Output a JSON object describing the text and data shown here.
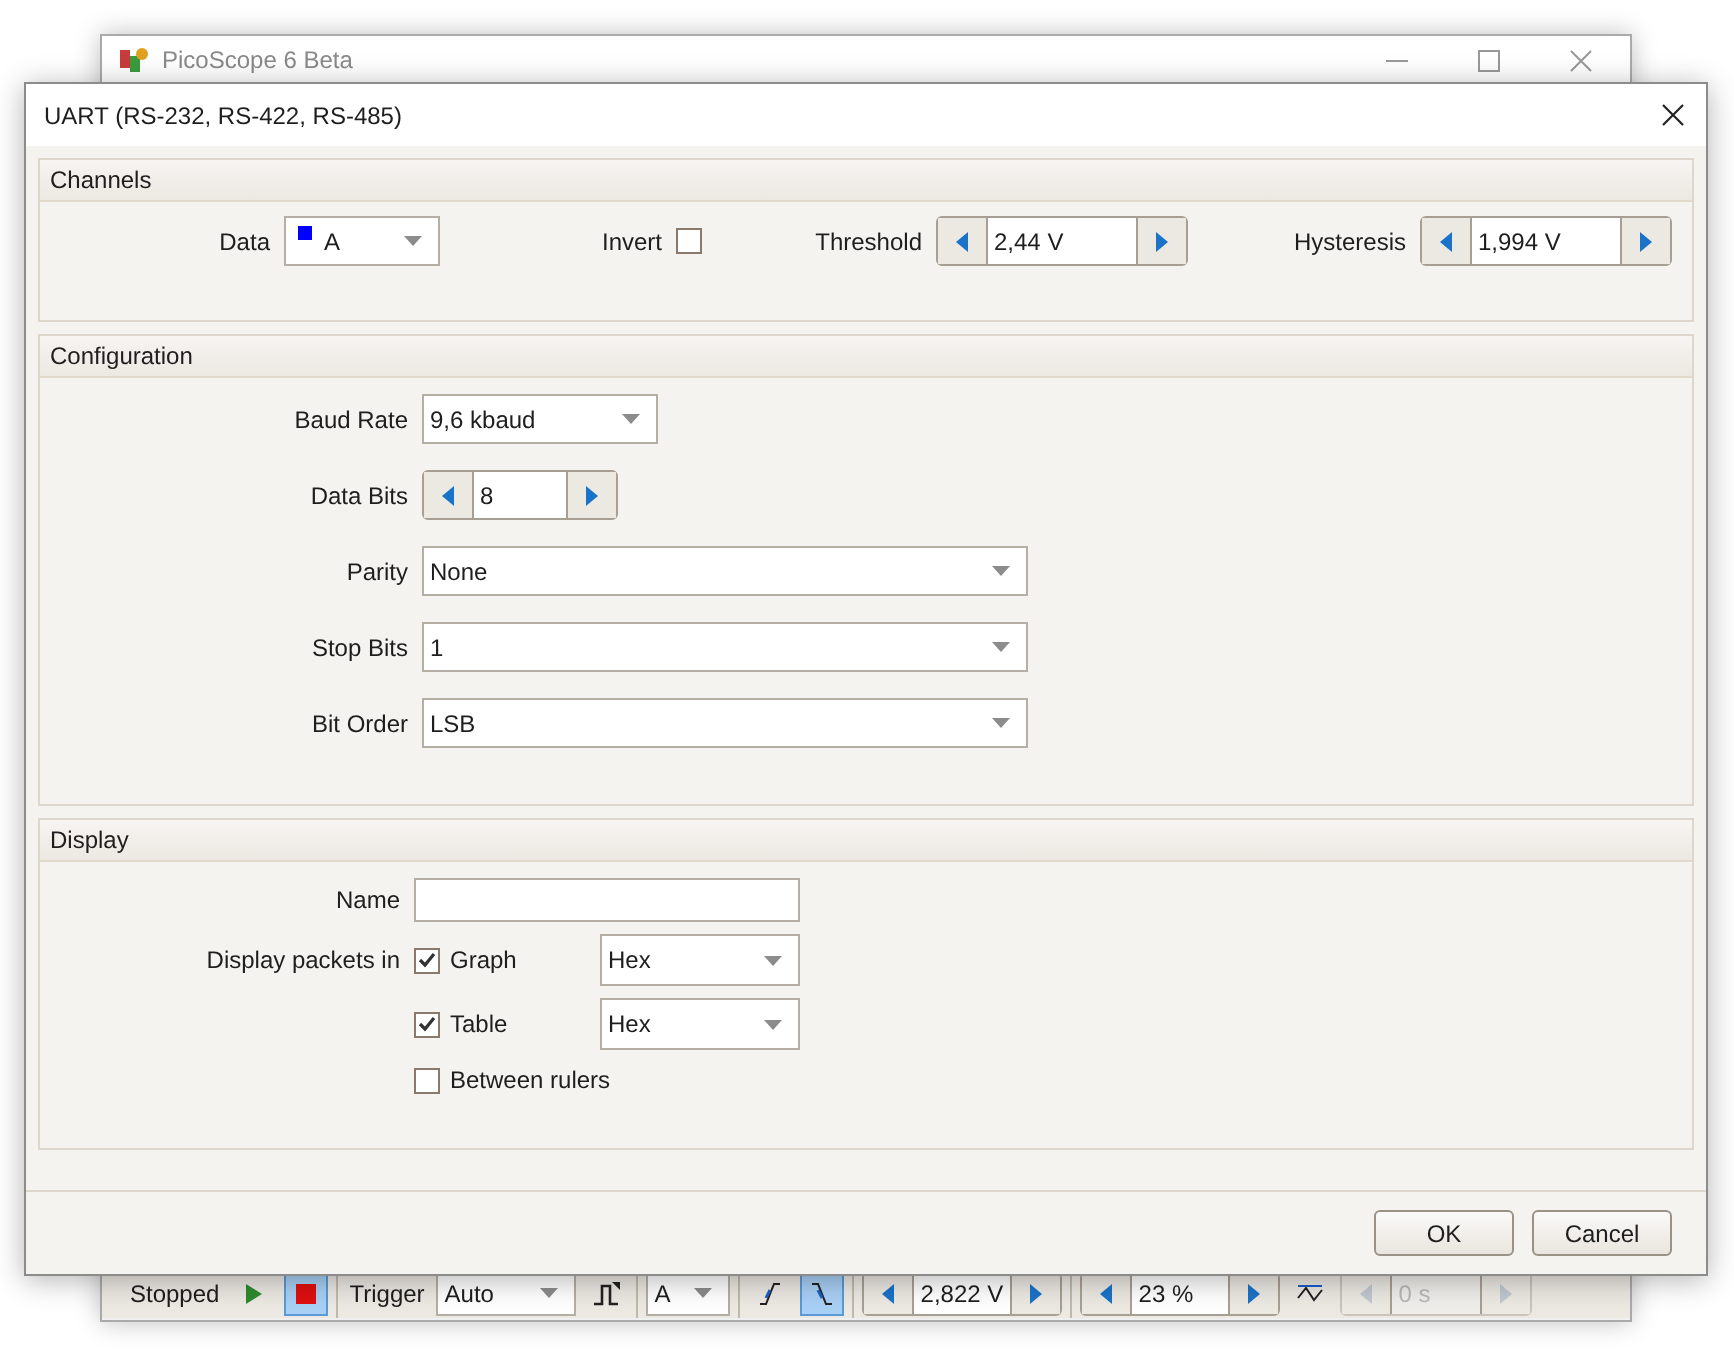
{
  "background_window": {
    "title": "PicoScope 6 Beta",
    "toolbar": {
      "groups": [
        [
          {
            "kind": "text",
            "text": "Stopped"
          },
          {
            "kind": "run_button",
            "selected": false
          },
          {
            "kind": "stop_button",
            "selected": true
          }
        ],
        [
          {
            "kind": "text",
            "text": "Trigger"
          },
          {
            "kind": "dropdown",
            "value": "Auto"
          },
          {
            "kind": "trigger_type_button",
            "selected": false
          }
        ],
        [
          {
            "kind": "dropdown",
            "value": "A"
          }
        ],
        [
          {
            "kind": "rising_edge_button",
            "selected": false
          },
          {
            "kind": "falling_edge_button",
            "selected": true
          }
        ],
        [
          {
            "kind": "spinner",
            "value": "2,822 V",
            "disabled": false
          }
        ],
        [
          {
            "kind": "spinner",
            "value": "23 %",
            "disabled": false
          },
          {
            "kind": "pretrigger_button",
            "selected": false
          },
          {
            "kind": "spinner",
            "value": "0 s",
            "disabled": true
          }
        ]
      ]
    }
  },
  "dialog": {
    "title": "UART (RS-232, RS-422, RS-485)",
    "sections": [
      {
        "title": "Channels",
        "fields": [
          {
            "kind": "dropdown",
            "label": "Data",
            "value": "A",
            "color": "#0000ff"
          },
          {
            "kind": "checkbox",
            "label": "Invert",
            "checked": false
          },
          {
            "kind": "spinner",
            "label": "Threshold",
            "value": "2,44 V"
          },
          {
            "kind": "spinner",
            "label": "Hysteresis",
            "value": "1,994 V"
          }
        ]
      },
      {
        "title": "Configuration",
        "fields": [
          {
            "kind": "dropdown",
            "label": "Baud Rate",
            "value": "9,6 kbaud"
          },
          {
            "kind": "spinner",
            "label": "Data Bits",
            "value": "8"
          },
          {
            "kind": "dropdown",
            "label": "Parity",
            "value": "None"
          },
          {
            "kind": "dropdown",
            "label": "Stop Bits",
            "value": "1"
          },
          {
            "kind": "dropdown",
            "label": "Bit Order",
            "value": "LSB"
          }
        ]
      },
      {
        "title": "Display",
        "fields": [
          {
            "kind": "text_input",
            "label": "Name"
          },
          {
            "kind": "check_dropdown",
            "label": "Display packets in",
            "check_label": "Graph",
            "checked": true,
            "value": "Hex"
          },
          {
            "kind": "check_dropdown",
            "check_label": "Table",
            "checked": true,
            "value": "Hex"
          },
          {
            "kind": "checkbox_row",
            "check_label": "Between rulers",
            "checked": false
          }
        ]
      }
    ],
    "buttons": [
      "OK",
      "Cancel"
    ]
  }
}
